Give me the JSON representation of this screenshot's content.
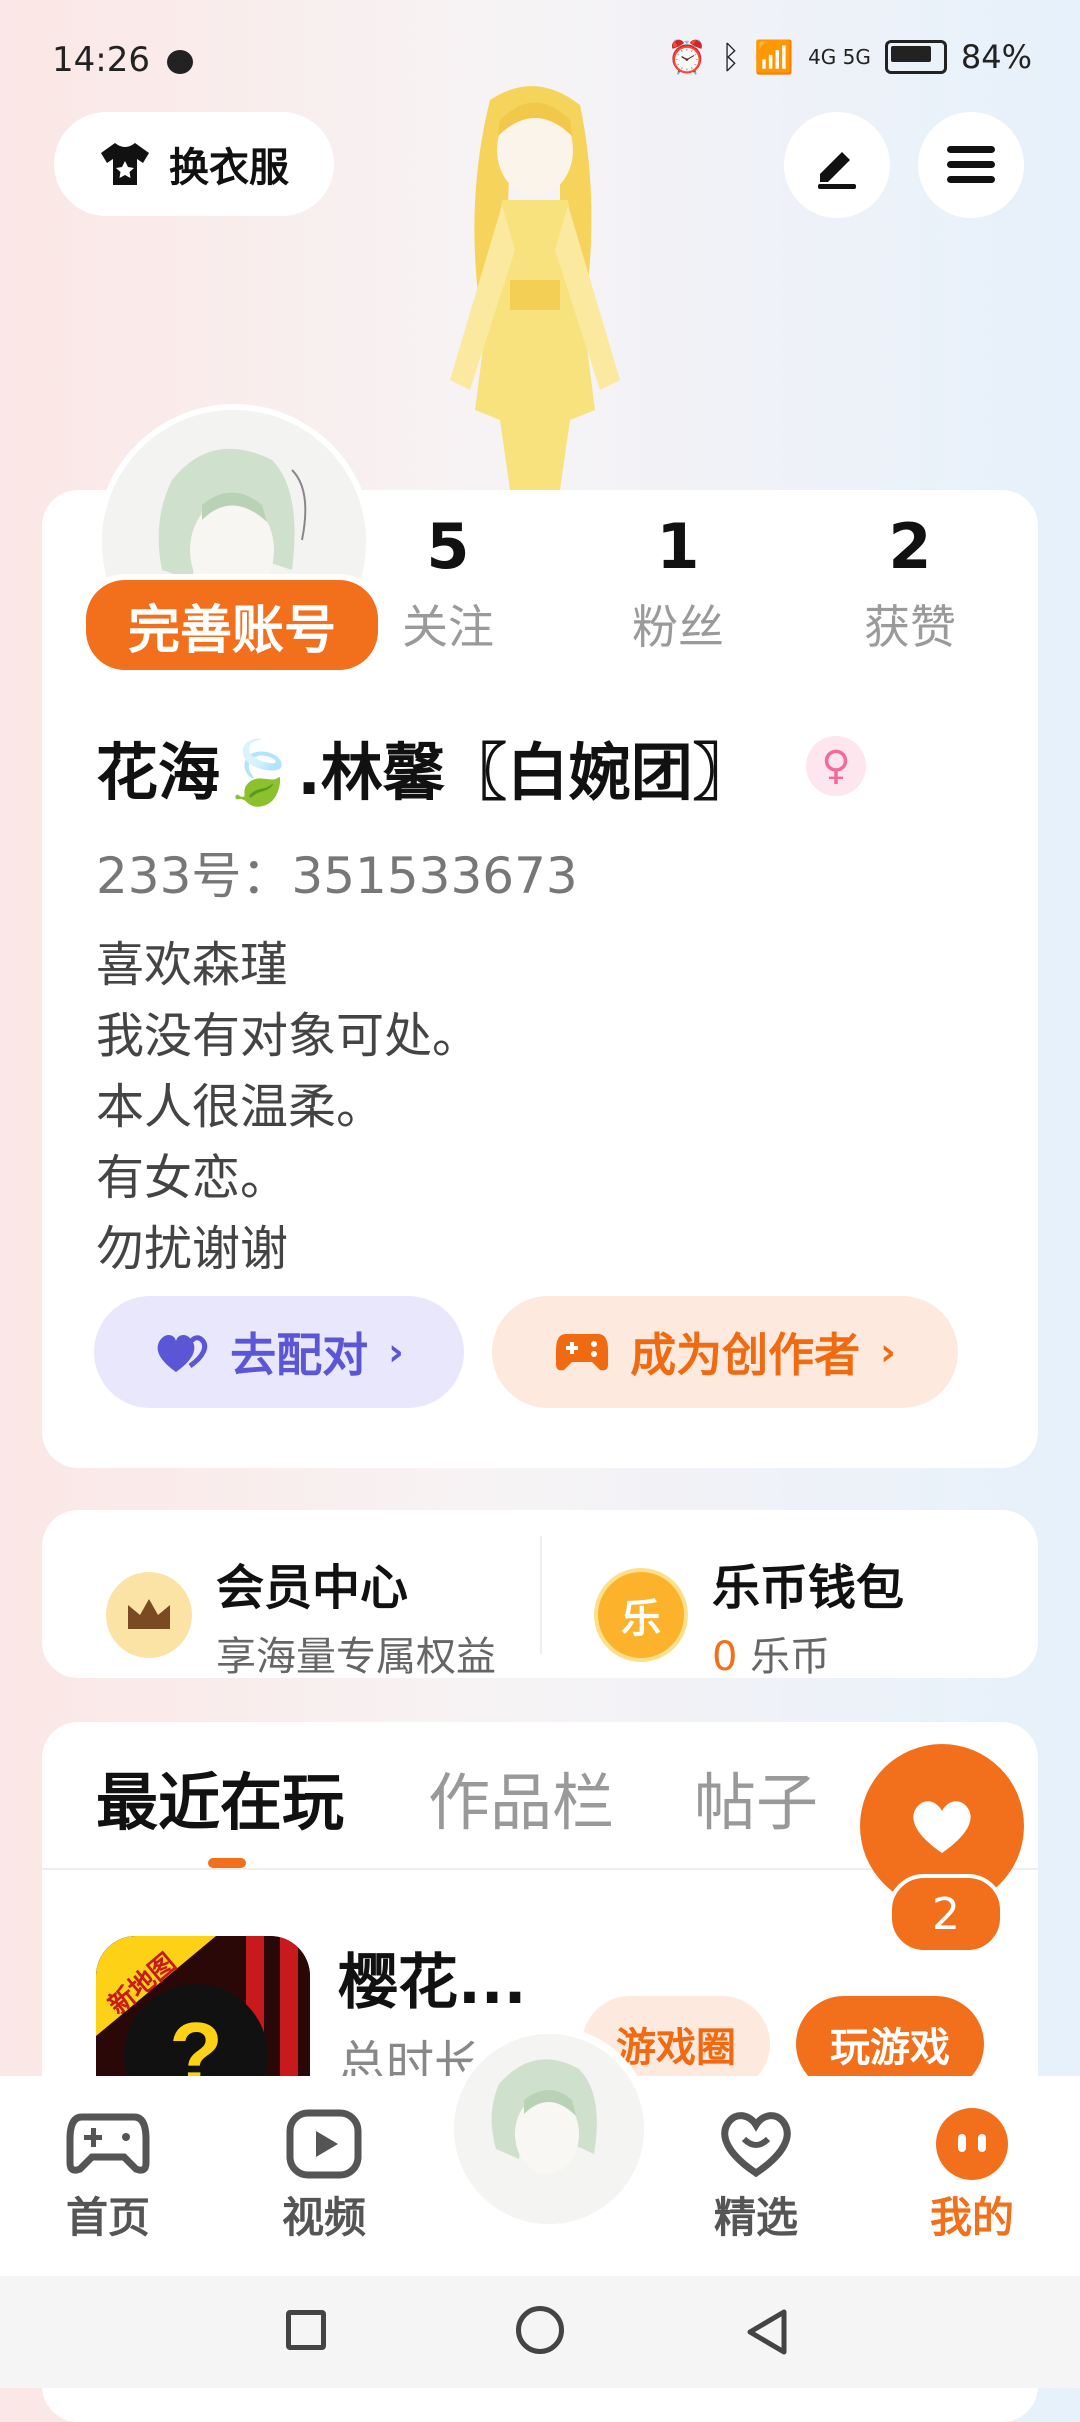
{
  "status_bar": {
    "time": "14:26",
    "network": "4G 5G",
    "battery": "84%"
  },
  "header": {
    "outfit_label": "换衣服"
  },
  "profile": {
    "complete_account_label": "完善账号",
    "stats": [
      {
        "value": "5",
        "label": "关注"
      },
      {
        "value": "1",
        "label": "粉丝"
      },
      {
        "value": "2",
        "label": "获赞"
      }
    ],
    "nickname": "花海🍃.林馨〖白婉团〗",
    "id_line": "233号：351533673",
    "bio": [
      "喜欢森瑾",
      "我没有对象可处。",
      "本人很温柔。",
      "有女恋。",
      "勿扰谢谢"
    ],
    "match_label": "去配对",
    "creator_label": "成为创作者"
  },
  "member": {
    "title": "会员中心",
    "subtitle": "享海量专属权益"
  },
  "wallet": {
    "title": "乐币钱包",
    "amount": "0",
    "unit": "乐币",
    "icon_char": "乐"
  },
  "tabs": [
    {
      "label": "最近在玩",
      "active": true
    },
    {
      "label": "作品栏",
      "active": false
    },
    {
      "label": "帖子",
      "active": false
    }
  ],
  "recent_game": {
    "title": "樱花...",
    "subtitle": "总时长",
    "badge": "新地图",
    "circle_label": "游戏圈",
    "play_label": "玩游戏"
  },
  "fab": {
    "count": "2"
  },
  "bottom_nav": [
    {
      "label": "首页",
      "icon": "gamepad-icon"
    },
    {
      "label": "视频",
      "icon": "video-icon"
    },
    {
      "label": "精选",
      "icon": "heart-chat-icon"
    },
    {
      "label": "我的",
      "icon": "profile-icon",
      "active": true
    }
  ],
  "colors": {
    "accent": "#f26f1c",
    "match": "#5b56d6",
    "active_nav": "#f26f1c"
  }
}
